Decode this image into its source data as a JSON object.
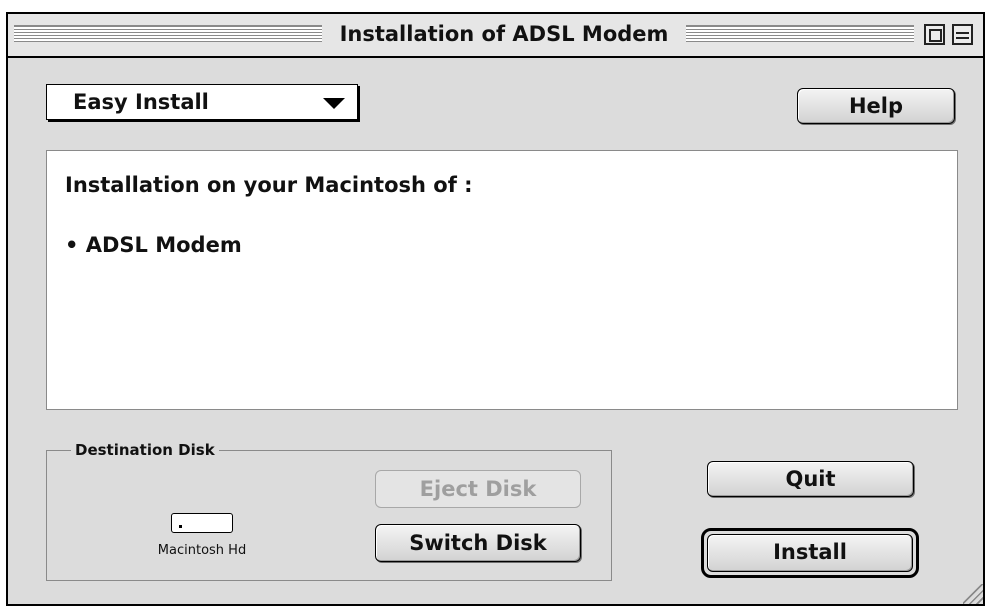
{
  "window": {
    "title": "Installation of ADSL Modem"
  },
  "install_mode": {
    "selected": "Easy Install"
  },
  "buttons": {
    "help": "Help",
    "eject_disk": "Eject Disk",
    "switch_disk": "Switch Disk",
    "quit": "Quit",
    "install": "Install"
  },
  "content": {
    "heading": "Installation on your Macintosh of :",
    "items": [
      "• ADSL Modem"
    ]
  },
  "destination": {
    "label": "Destination Disk",
    "disk_name": "Macintosh Hd"
  },
  "icons": {
    "zoom": "zoom-box-icon",
    "collapse": "collapse-box-icon",
    "popup_arrow": "triangle-down-icon",
    "disk": "hard-disk-icon",
    "resize": "resize-grip-icon"
  }
}
